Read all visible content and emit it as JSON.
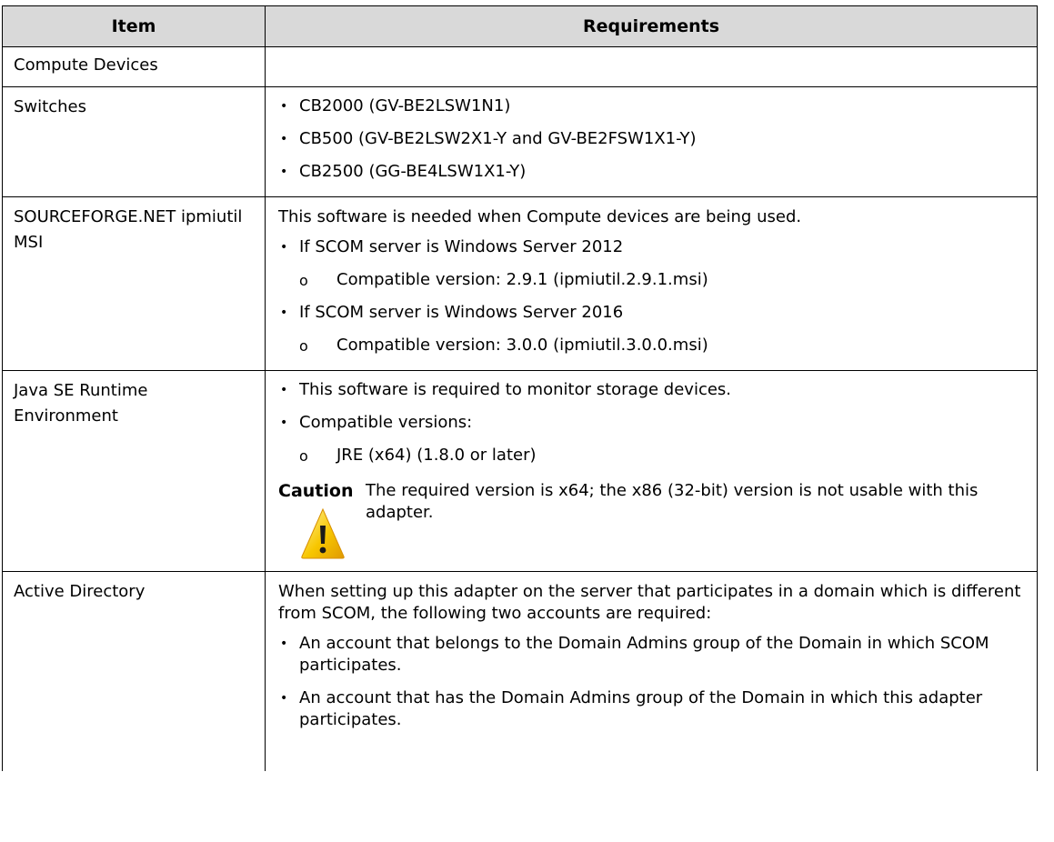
{
  "table": {
    "headers": {
      "item": "Item",
      "requirements": "Requirements"
    },
    "compute": {
      "item": "Compute Devices"
    },
    "switches": {
      "item": "Switches",
      "bullets": [
        "CB2000 (GV-BE2LSW1N1)",
        "CB500 (GV-BE2LSW2X1-Y and GV-BE2FSW1X1-Y)",
        "CB2500 (GG-BE4LSW1X1-Y)"
      ]
    },
    "ipmiutil": {
      "item": "SOURCEFORGE.NET ipmiutil MSI",
      "intro": "This software is needed when Compute devices are being used.",
      "bullet1": "If SCOM server is Windows Server 2012",
      "sub1": "Compatible version:  2.9.1 (ipmiutil.2.9.1.msi)",
      "bullet2": "If SCOM server is Windows Server 2016",
      "sub2": "Compatible version:  3.0.0 (ipmiutil.3.0.0.msi)"
    },
    "java": {
      "item": "Java SE Runtime Environment",
      "bullet1": "This software is required to monitor storage devices.",
      "bullet2": "Compatible versions:",
      "sub1": "JRE (x64) (1.8.0 or later)",
      "caution_label": "Caution",
      "caution_text": "The required version is x64; the x86 (32-bit) version is not usable with this adapter.",
      "caution_icon": "warning-triangle-icon",
      "caution_icon_color": "#f5b800"
    },
    "ad": {
      "item": "Active Directory",
      "intro": "When setting up this adapter on the server that participates in a domain which is different from SCOM, the following two accounts are required:",
      "bullet1": "An account that belongs to the Domain Admins group of the Domain in which SCOM participates.",
      "bullet2": "An account that has the Domain Admins group of the Domain in which this adapter participates."
    }
  }
}
